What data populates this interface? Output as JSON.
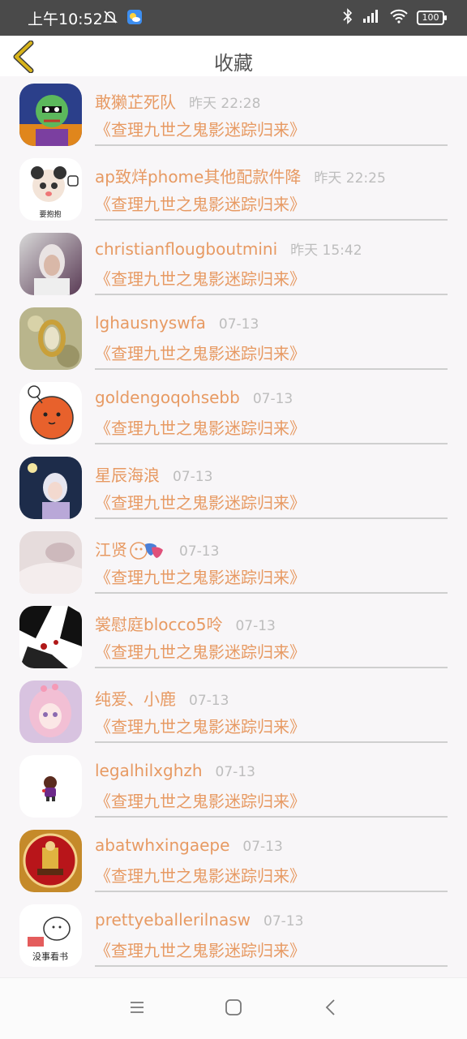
{
  "status_bar": {
    "time": "上午10:52",
    "battery": "100"
  },
  "header": {
    "title": "收藏"
  },
  "rows": [
    {
      "name": "敢獭芷死队",
      "time": "昨天 22:28",
      "title": "《查理九世之鬼影迷踪归来》"
    },
    {
      "name": "ap致烊phome其他配款件降",
      "time": "昨天 22:25",
      "title": "《查理九世之鬼影迷踪归来》"
    },
    {
      "name": "christianflougboutmini",
      "time": "昨天 15:42",
      "title": "《查理九世之鬼影迷踪归来》"
    },
    {
      "name": "lghausnyswfa",
      "time": "07-13",
      "title": "《查理九世之鬼影迷踪归来》"
    },
    {
      "name": "goldengoqohsebb",
      "time": "07-13",
      "title": "《查理九世之鬼影迷踪归来》"
    },
    {
      "name": "星辰海浪",
      "time": "07-13",
      "title": "《查理九世之鬼影迷踪归来》"
    },
    {
      "name": "江贤",
      "time": "07-13",
      "title": "《查理九世之鬼影迷踪归来》"
    },
    {
      "name": "裳慰庭blocco5呤",
      "time": "07-13",
      "title": "《查理九世之鬼影迷踪归来》"
    },
    {
      "name": "纯爱、小鹿",
      "time": "07-13",
      "title": "《查理九世之鬼影迷踪归来》"
    },
    {
      "name": "legalhilxghzh",
      "time": "07-13",
      "title": "《查理九世之鬼影迷踪归来》"
    },
    {
      "name": "abatwhxingaepe",
      "time": "07-13",
      "title": "《查理九世之鬼影迷踪归来》"
    },
    {
      "name": "prettyeballerilnasw",
      "time": "07-13",
      "title": "《查理九世之鬼影迷踪归来》"
    }
  ],
  "avatar_captions": {
    "row1": "要抱抱",
    "row11": "没事看书"
  },
  "colors": {
    "accent": "#e79a63",
    "time_gray": "#bdbdbd",
    "back_arrow": "#d8b41a"
  }
}
